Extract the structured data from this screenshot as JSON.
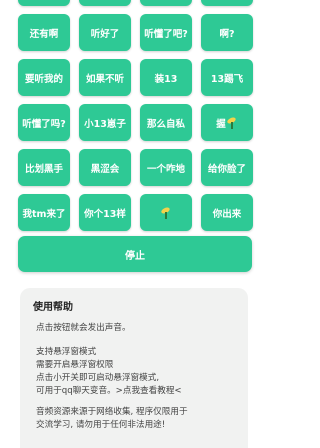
{
  "buttons_row0": [
    "",
    "",
    "",
    ""
  ],
  "buttons": [
    {
      "label": "还有啊"
    },
    {
      "label": "听好了"
    },
    {
      "label": "听懂了吧?"
    },
    {
      "label": "啊?"
    },
    {
      "label": "要听我的"
    },
    {
      "label": "如果不听"
    },
    {
      "label": "装13"
    },
    {
      "label": "13踢飞"
    },
    {
      "label": "听懂了吗?"
    },
    {
      "label": "小13崽子"
    },
    {
      "label": "那么自私"
    },
    {
      "label": "握",
      "icon": "leaf-icon"
    },
    {
      "label": "比划黑手"
    },
    {
      "label": "黑涩会"
    },
    {
      "label": "一个咋地"
    },
    {
      "label": "给你脸了"
    },
    {
      "label": "我tm来了"
    },
    {
      "label": "你个13样"
    },
    {
      "label": "",
      "icon": "leaf-icon"
    },
    {
      "label": "你出来"
    }
  ],
  "stop_label": "停止",
  "help": {
    "title": "使用帮助",
    "line1": "点击按钮就会发出声音。",
    "line2": "支持悬浮窗模式",
    "line3": "需要开启悬浮窗权限",
    "line4": "点击小开关即可启动悬浮窗模式,",
    "line5": "可用于qq聊天变音。>点我查看教程<",
    "line6": "音频资源来源于网络收集, 程序仅限用于",
    "line7": "交流学习, 请勿用于任何非法用途!"
  }
}
